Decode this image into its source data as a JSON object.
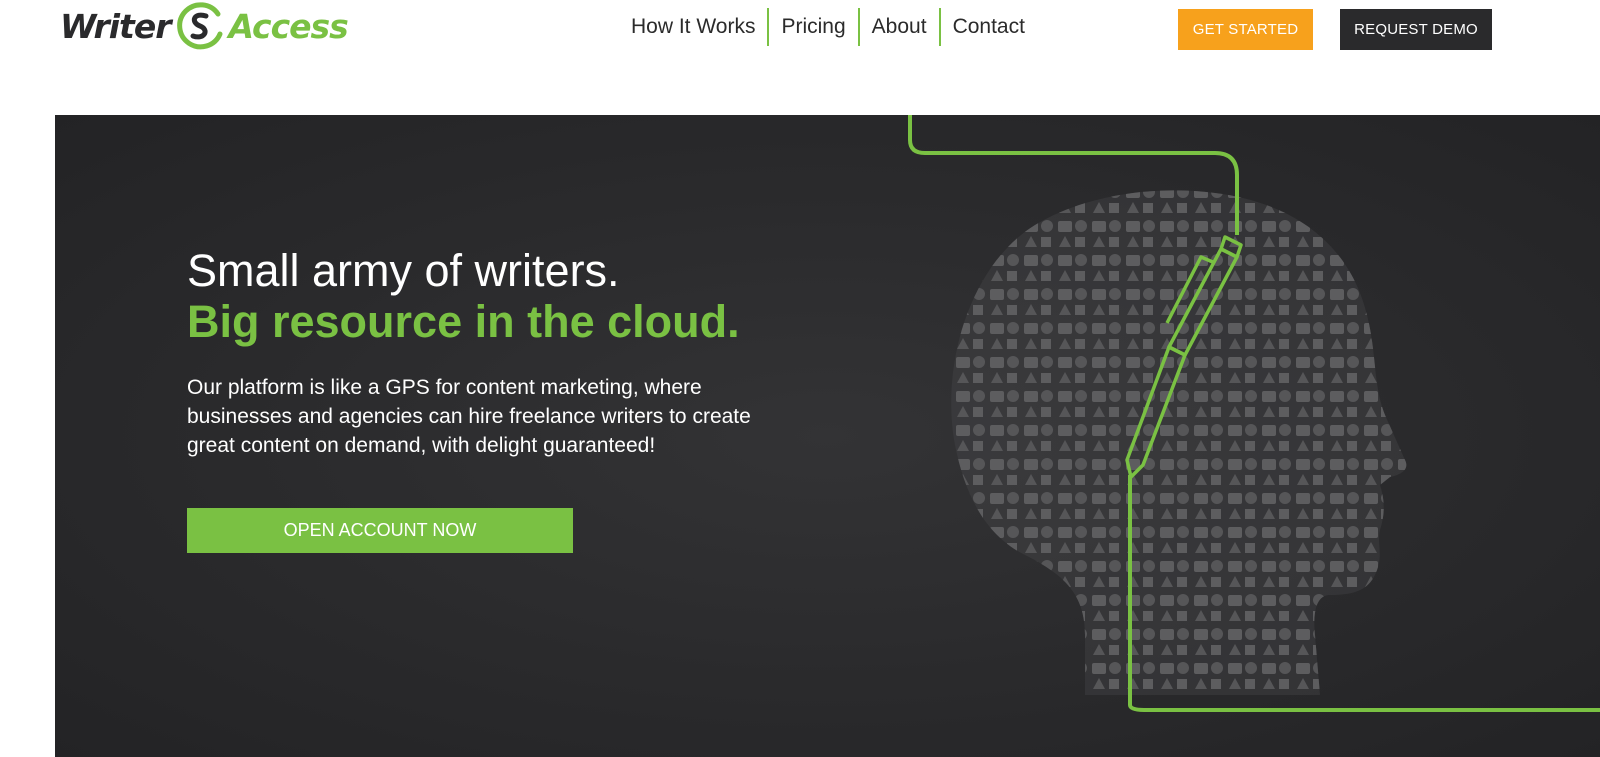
{
  "logo": {
    "word1": "Writer",
    "word2": "Access",
    "brand_color": "#7ac143"
  },
  "nav": {
    "items": [
      {
        "label": "How It Works"
      },
      {
        "label": "Pricing"
      },
      {
        "label": "About"
      },
      {
        "label": "Contact"
      }
    ],
    "separator_color": "#7ac143"
  },
  "header_buttons": {
    "get_started": "GET STARTED",
    "request_demo": "REQUEST DEMO"
  },
  "hero": {
    "headline_line1": "Small army of writers.",
    "headline_line2": "Big resource in the cloud.",
    "description": "Our platform is like a GPS for content marketing, where businesses and agencies can hire freelance writers to create great content on demand, with delight guaranteed!",
    "cta_label": "OPEN ACCOUNT NOW",
    "illustration_icon": "head-silhouette-of-business-icons-with-pen"
  },
  "colors": {
    "accent_green": "#7ac143",
    "accent_orange": "#f7a11c",
    "dark": "#2a2a2c"
  }
}
